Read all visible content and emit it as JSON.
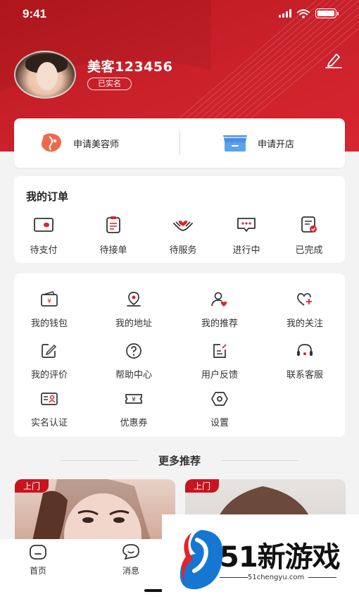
{
  "status_bar": {
    "time": "9:41"
  },
  "profile": {
    "username": "美客123456",
    "verified_label": "已实名"
  },
  "apply": {
    "beautician_label": "申请美容师",
    "open_store_label": "申请开店"
  },
  "orders": {
    "title": "我的订单",
    "items": [
      {
        "label": "待支付",
        "icon": "wallet-icon"
      },
      {
        "label": "待接单",
        "icon": "clipboard-icon"
      },
      {
        "label": "待服务",
        "icon": "heart-hands-icon"
      },
      {
        "label": "进行中",
        "icon": "chat-dots-icon"
      },
      {
        "label": "已完成",
        "icon": "checklist-icon"
      }
    ]
  },
  "services": [
    {
      "label": "我的钱包",
      "icon": "yen-wallet-icon"
    },
    {
      "label": "我的地址",
      "icon": "location-icon"
    },
    {
      "label": "我的推荐",
      "icon": "user-heart-icon"
    },
    {
      "label": "我的关注",
      "icon": "heart-plus-icon"
    },
    {
      "label": "我的评价",
      "icon": "edit-icon"
    },
    {
      "label": "帮助中心",
      "icon": "question-icon"
    },
    {
      "label": "用户反馈",
      "icon": "feedback-icon"
    },
    {
      "label": "联系客服",
      "icon": "headset-icon"
    },
    {
      "label": "实名认证",
      "icon": "id-card-icon"
    },
    {
      "label": "优惠券",
      "icon": "coupon-icon"
    },
    {
      "label": "设置",
      "icon": "settings-icon"
    }
  ],
  "recommend": {
    "title": "更多推荐",
    "cards": [
      {
        "tag": "上门"
      },
      {
        "tag": "上门"
      }
    ]
  },
  "bottom_nav": [
    {
      "label": "首页",
      "icon": "home-icon"
    },
    {
      "label": "消息",
      "icon": "message-icon"
    }
  ],
  "watermark": {
    "text": "51新游戏",
    "url": "51chengyu.com"
  },
  "colors": {
    "brand_red": "#c8202a",
    "icon_red": "#d9252f",
    "text": "#333333"
  }
}
